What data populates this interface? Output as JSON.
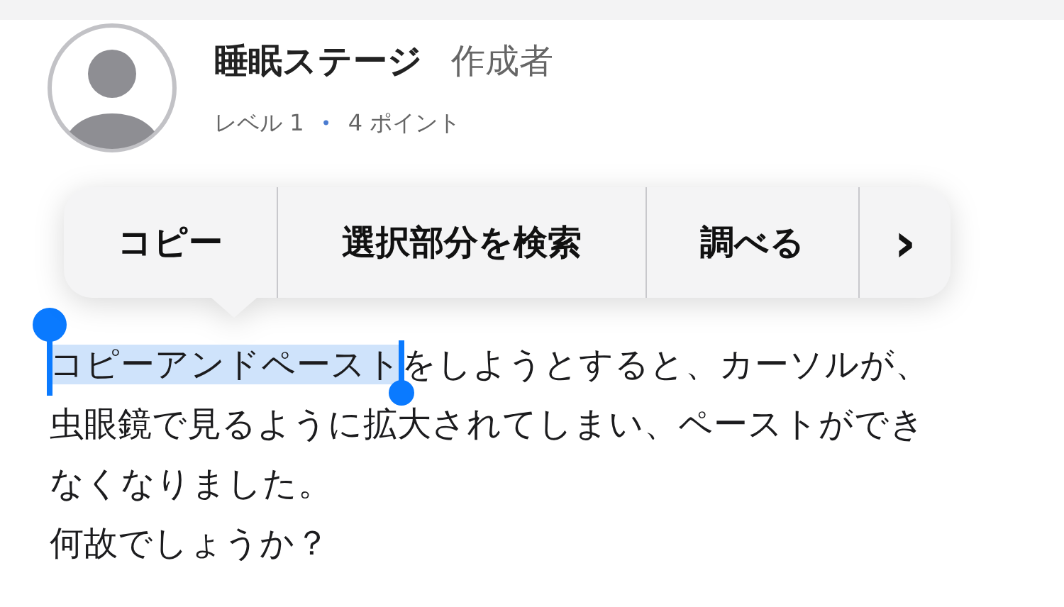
{
  "author": {
    "name": "睡眠ステージ",
    "role": "作成者",
    "level": "レベル 1",
    "separator": "•",
    "points": "4 ポイント"
  },
  "context_menu": {
    "items": [
      {
        "kind": "text",
        "label": "コピー"
      },
      {
        "kind": "text",
        "label": "選択部分を検索"
      },
      {
        "kind": "text",
        "label": "調べる"
      },
      {
        "kind": "more",
        "label": "›"
      }
    ]
  },
  "body": {
    "paragraphs": [
      {
        "selection": "コピーアンドペースト",
        "text": "をしようとすると、カーソルが、虫眼鏡で見るように拡大されてしまい、ペーストができなくなりました。"
      },
      {
        "text": "何故でしょうか？"
      }
    ]
  }
}
